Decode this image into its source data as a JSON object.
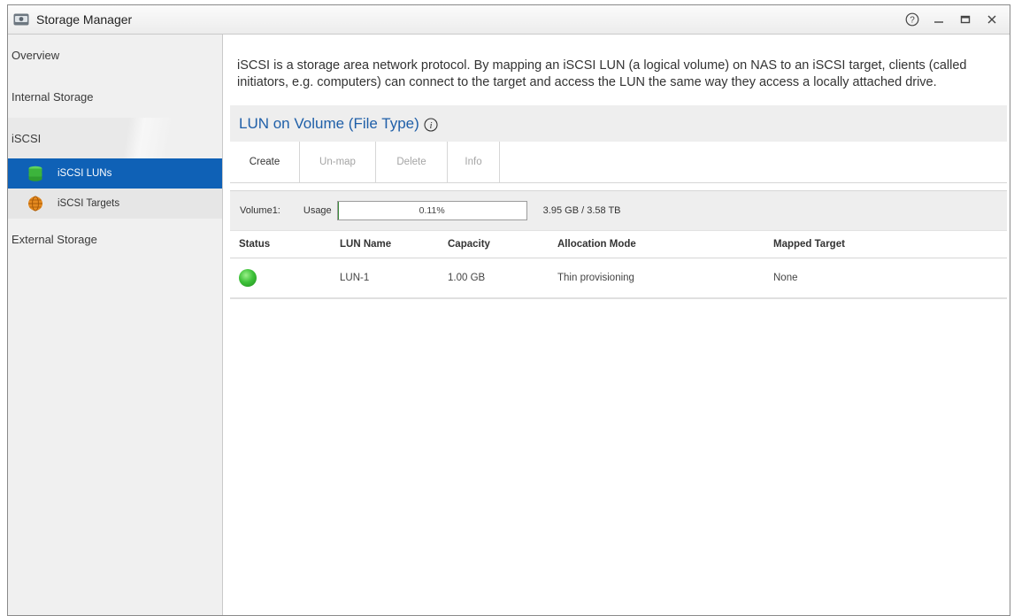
{
  "window": {
    "title": "Storage Manager",
    "icons": {
      "app": "drive-icon",
      "help": "help-icon",
      "minimize": "minimize-icon",
      "maximize": "maximize-icon",
      "close": "close-icon"
    }
  },
  "sidebar": {
    "items": [
      {
        "label": "Overview"
      },
      {
        "label": "Internal Storage"
      },
      {
        "label": "iSCSI"
      },
      {
        "label": "External Storage"
      }
    ],
    "sub_items": [
      {
        "label": "iSCSI LUNs",
        "icon": "database-icon"
      },
      {
        "label": "iSCSI Targets",
        "icon": "globe-icon"
      }
    ]
  },
  "main": {
    "description": "iSCSI is a storage area network protocol. By mapping an iSCSI LUN (a logical volume) on NAS to an iSCSI target, clients (called initiators, e.g. computers) can connect to the target and access the LUN the same way they access a locally attached drive.",
    "section_title": "LUN on Volume (File Type)",
    "toolbar": {
      "create": "Create",
      "unmap": "Un-map",
      "delete": "Delete",
      "info": "Info"
    },
    "volume": {
      "name": "Volume1:",
      "usage_label": "Usage",
      "usage_percent": "0.11%",
      "usage_fraction": 0.0011,
      "size": "3.95 GB / 3.58 TB"
    },
    "table": {
      "headers": [
        "Status",
        "LUN Name",
        "Capacity",
        "Allocation Mode",
        "Mapped Target"
      ],
      "rows": [
        {
          "status": "online",
          "lun_name": "LUN-1",
          "capacity": "1.00 GB",
          "allocation_mode": "Thin provisioning",
          "mapped_target": "None"
        }
      ]
    }
  },
  "colors": {
    "accent": "#0f61b6",
    "header_text": "#1f5fa8",
    "status_ok": "#3fc23a"
  }
}
